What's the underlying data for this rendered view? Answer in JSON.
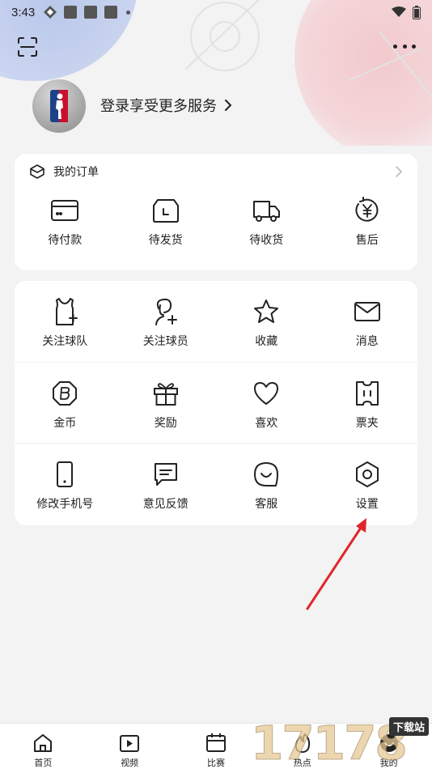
{
  "status_bar": {
    "time": "3:43"
  },
  "profile": {
    "login_text": "登录享受更多服务"
  },
  "orders": {
    "title": "我的订单",
    "items": [
      {
        "label": "待付款",
        "icon": "wallet-card-icon"
      },
      {
        "label": "待发货",
        "icon": "package-clock-icon"
      },
      {
        "label": "待收货",
        "icon": "delivery-truck-icon"
      },
      {
        "label": "售后",
        "icon": "refund-yen-icon"
      }
    ]
  },
  "services": {
    "rows": [
      [
        {
          "label": "关注球队",
          "icon": "jersey-plus-icon"
        },
        {
          "label": "关注球员",
          "icon": "player-plus-icon"
        },
        {
          "label": "收藏",
          "icon": "star-icon"
        },
        {
          "label": "消息",
          "icon": "mail-icon"
        }
      ],
      [
        {
          "label": "金币",
          "icon": "coin-icon"
        },
        {
          "label": "奖励",
          "icon": "gift-icon"
        },
        {
          "label": "喜欢",
          "icon": "heart-icon"
        },
        {
          "label": "票夹",
          "icon": "ticket-icon"
        }
      ],
      [
        {
          "label": "修改手机号",
          "icon": "phone-icon"
        },
        {
          "label": "意见反馈",
          "icon": "feedback-icon"
        },
        {
          "label": "客服",
          "icon": "customer-service-icon"
        },
        {
          "label": "设置",
          "icon": "settings-hex-icon"
        }
      ]
    ]
  },
  "bottom_nav": {
    "items": [
      {
        "label": "首页",
        "icon": "home-icon"
      },
      {
        "label": "视频",
        "icon": "video-icon"
      },
      {
        "label": "比赛",
        "icon": "calendar-icon"
      },
      {
        "label": "热点",
        "icon": "fire-icon"
      },
      {
        "label": "我的",
        "icon": "smile-icon"
      }
    ]
  },
  "watermark": {
    "number": "17178",
    "tag": "下载站"
  },
  "colors": {
    "accent_red": "#e0262b",
    "text": "#111111",
    "background": "#f3f3f3"
  }
}
